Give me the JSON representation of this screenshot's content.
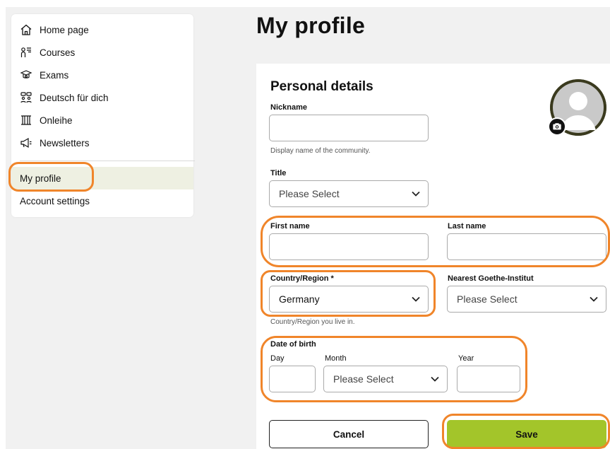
{
  "sidebar": {
    "items": [
      {
        "label": "Home page",
        "icon": "home-icon"
      },
      {
        "label": "Courses",
        "icon": "courses-icon"
      },
      {
        "label": "Exams",
        "icon": "exams-icon"
      },
      {
        "label": "Deutsch für dich",
        "icon": "community-icon"
      },
      {
        "label": "Onleihe",
        "icon": "library-icon"
      },
      {
        "label": "Newsletters",
        "icon": "megaphone-icon"
      }
    ],
    "active_item": "My profile",
    "account_settings": "Account settings"
  },
  "page": {
    "title": "My profile"
  },
  "card": {
    "title": "Personal details",
    "nickname": {
      "label": "Nickname",
      "value": "",
      "help": "Display name of the community."
    },
    "title_field": {
      "label": "Title",
      "value": "Please Select"
    },
    "first_name": {
      "label": "First name",
      "value": ""
    },
    "last_name": {
      "label": "Last name",
      "value": ""
    },
    "country": {
      "label": "Country/Region *",
      "value": "Germany",
      "help": "Country/Region you live in."
    },
    "nearest_institute": {
      "label": "Nearest Goethe-Institut",
      "value": "Please Select"
    },
    "dob": {
      "label": "Date of birth",
      "day_label": "Day",
      "day_value": "",
      "month_label": "Month",
      "month_value": "Please Select",
      "year_label": "Year",
      "year_value": ""
    },
    "cancel": "Cancel",
    "save": "Save"
  },
  "colors": {
    "accent": "#a3c52a",
    "highlight": "#f0852a",
    "active_nav_bg": "#eef0e2"
  }
}
